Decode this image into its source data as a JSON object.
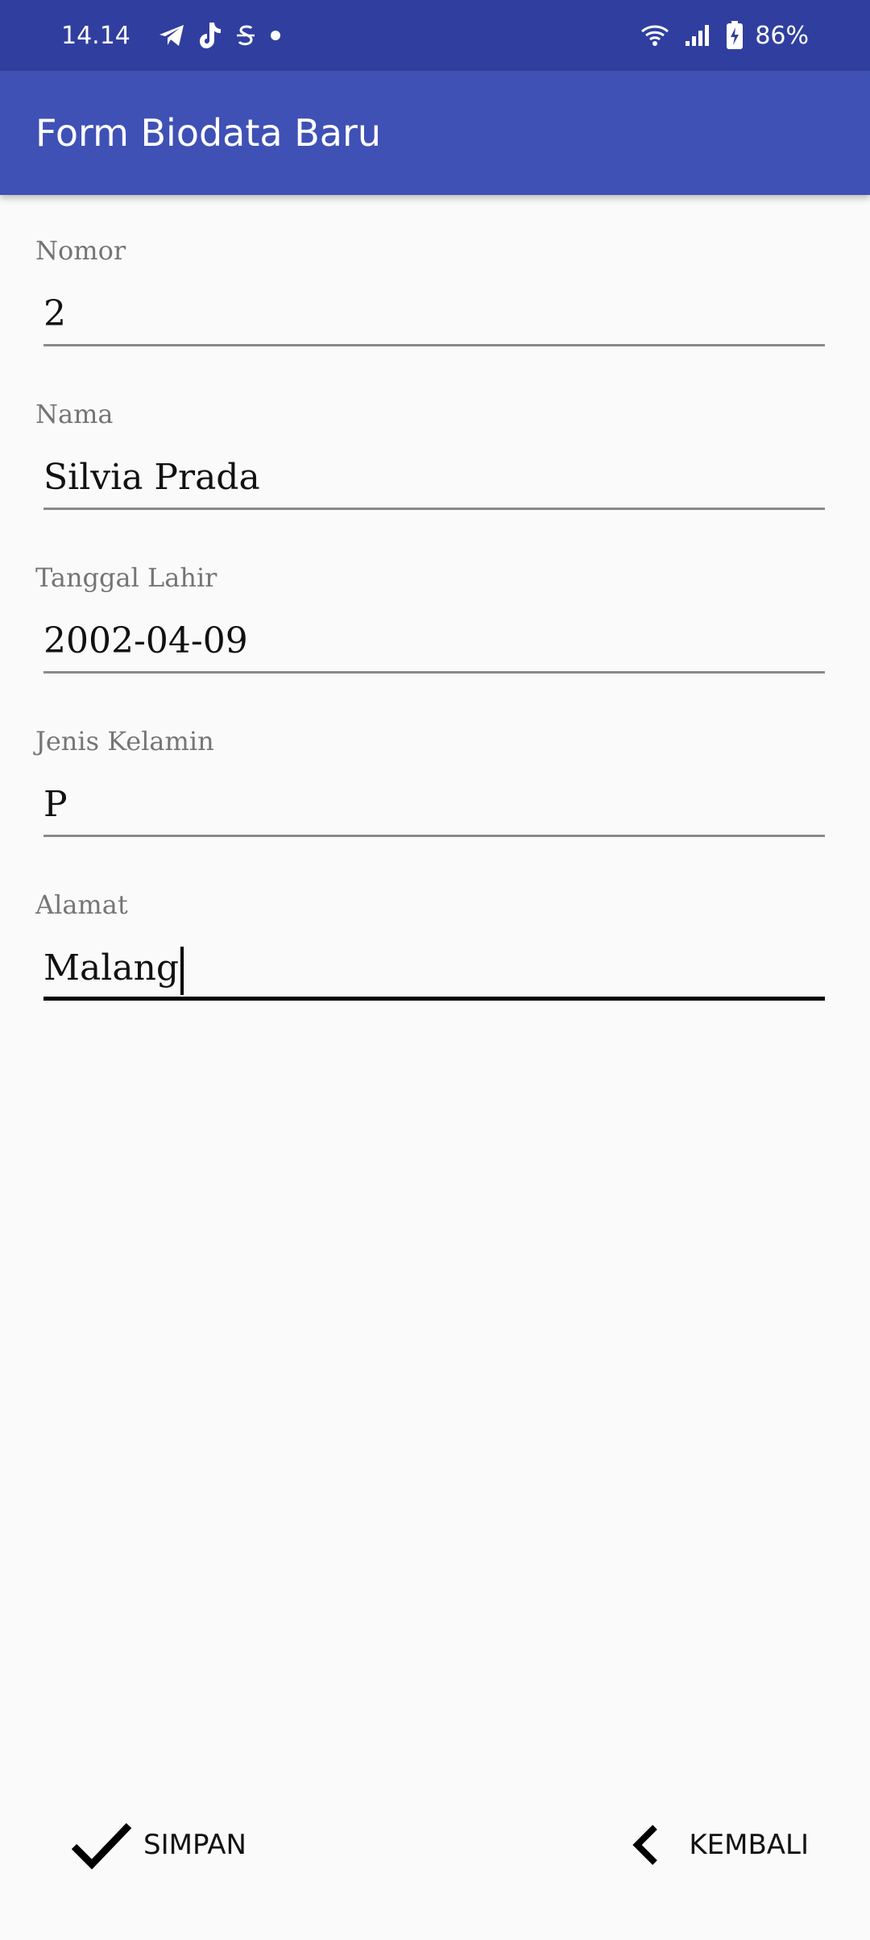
{
  "status_bar": {
    "time": "14.14",
    "battery": "86%",
    "icons_left": [
      "telegram-icon",
      "tiktok-icon",
      "s-icon",
      "dot-icon"
    ],
    "icons_right": [
      "wifi-icon",
      "signal-icon",
      "battery-charging-icon"
    ]
  },
  "app_bar": {
    "title": "Form Biodata Baru"
  },
  "form": {
    "nomor": {
      "label": "Nomor",
      "value": "2"
    },
    "nama": {
      "label": "Nama",
      "value": "Silvia Prada"
    },
    "tanggal_lahir": {
      "label": "Tanggal Lahir",
      "value": "2002-04-09"
    },
    "jenis_kelamin": {
      "label": "Jenis Kelamin",
      "value": "P"
    },
    "alamat": {
      "label": "Alamat",
      "value": "Malang"
    }
  },
  "actions": {
    "save_label": "SIMPAN",
    "back_label": "KEMBALI"
  },
  "colors": {
    "status_bar": "#303f9f",
    "app_bar": "#3f51b5",
    "background": "#fafafa"
  }
}
